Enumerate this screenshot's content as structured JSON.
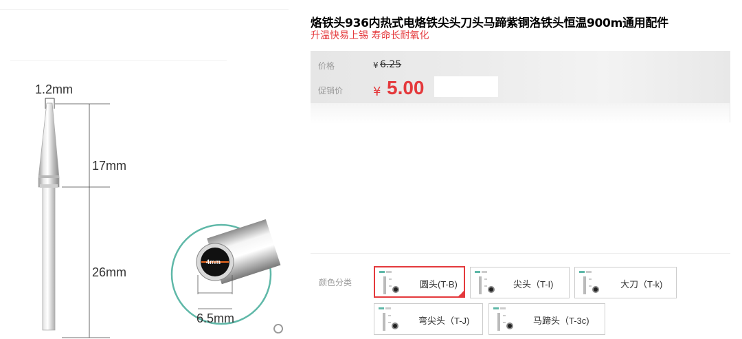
{
  "product": {
    "title": "烙铁头936内热式电烙铁尖头刀头马蹄紫铜洛铁头恒温900m通用配件",
    "subtitle": "升温快易上锡 寿命长耐氧化"
  },
  "image": {
    "labels": {
      "tip": "1.2mm",
      "upper": "17mm",
      "lower": "26mm",
      "inner": "4mm",
      "outer": "6.5mm"
    }
  },
  "price": {
    "original_label": "价格",
    "currency": "¥",
    "original_value": "6.25",
    "promo_label": "促销价",
    "promo_value": "5.00"
  },
  "sku": {
    "label": "颜色分类",
    "options": [
      {
        "name": "圆头(T-B)",
        "selected": true
      },
      {
        "name": "尖头（T-I)",
        "selected": false
      },
      {
        "name": "大刀（T-k)",
        "selected": false
      },
      {
        "name": "弯尖头（T-J)",
        "selected": false
      },
      {
        "name": "马蹄头（T-3c)",
        "selected": false
      }
    ]
  },
  "colors": {
    "accent": "#e4393c",
    "teal": "#5fb8a8"
  }
}
